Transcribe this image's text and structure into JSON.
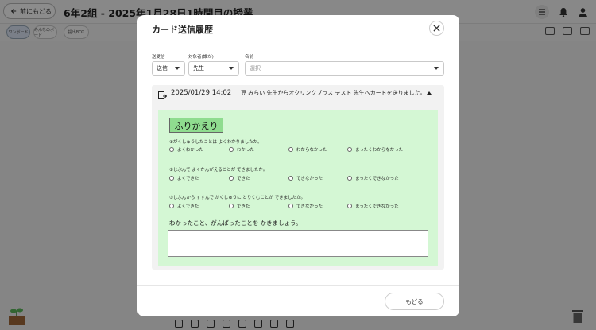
{
  "app": {
    "back_button_label": "前にもどる",
    "page_title": "6年2組 - 2025年1月28日1時間目の授業",
    "subbar_pills": [
      "ワンボード",
      "みんなのボード",
      "提出BOX"
    ]
  },
  "modal": {
    "title": "カード送信履歴",
    "filters": {
      "direction": {
        "label": "送受信",
        "value": "送信"
      },
      "target": {
        "label": "対象者(誰が)",
        "value": "先生"
      },
      "name": {
        "label": "名前",
        "placeholder": "選択"
      }
    },
    "history": {
      "datetime": "2025/01/29  14:02",
      "message": "豆 みらい 先生からオクリンクプラス テスト 先生へカードを送りました。",
      "card": {
        "title": "ふりかえり",
        "questions": [
          {
            "text": "①がくしゅうしたことは よくわかりましたか。",
            "options": [
              "よくわかった",
              "わかった",
              "わからなかった",
              "まったくわからなかった"
            ]
          },
          {
            "text": "②じぶんで よくかんがえることが できましたか。",
            "options": [
              "よくできた",
              "できた",
              "できなかった",
              "まったくできなかった"
            ]
          },
          {
            "text": "③じぶんから すすんで がくしゅうに とりくむことが できましたか。",
            "options": [
              "よくできた",
              "できた",
              "できなかった",
              "まったくできなかった"
            ]
          }
        ],
        "free_label": "わかったこと、がんばったことを かきましょう。"
      }
    },
    "footer": {
      "back_label": "もどる"
    }
  }
}
